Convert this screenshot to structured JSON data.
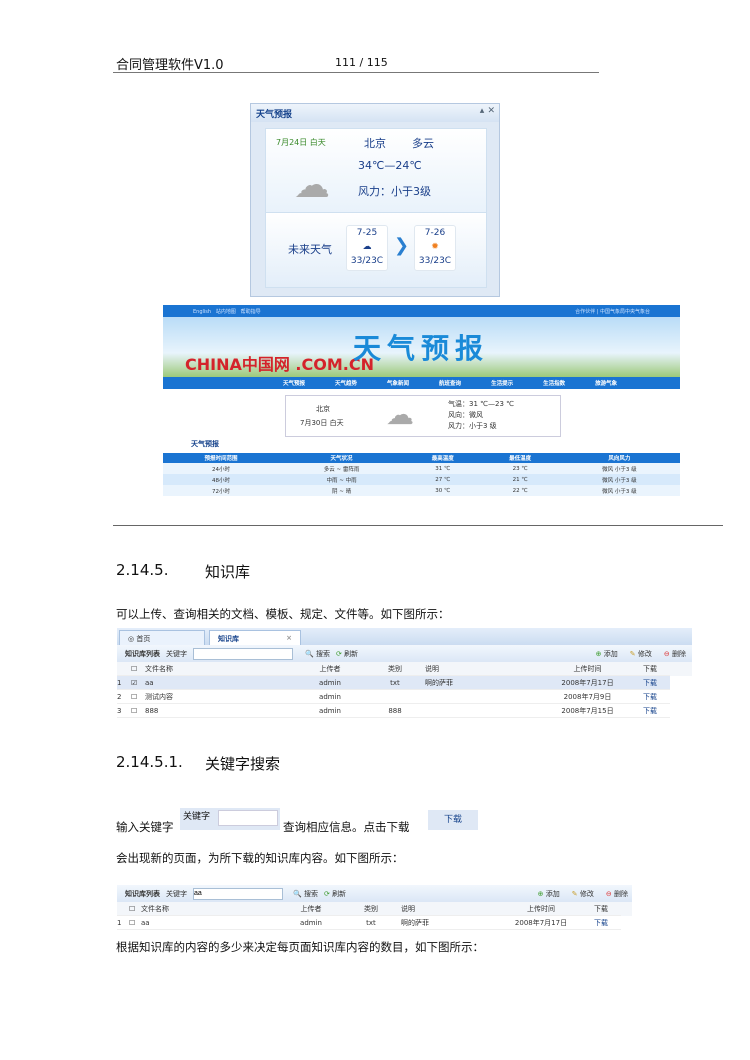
{
  "header": {
    "title": "合同管理软件V1.0",
    "page": "111 / 115"
  },
  "weather_widget": {
    "title": "天气预报",
    "date": "7月24日 白天",
    "city": "北京",
    "condition": "多云",
    "temp": "34℃—24℃",
    "wind": "风力：小于3级",
    "future_label": "未来天气",
    "days": [
      {
        "date": "7-25",
        "temp": "33/23C",
        "icon": "cloud-icon"
      },
      {
        "date": "7-26",
        "temp": "33/23C",
        "icon": "sun-icon"
      }
    ]
  },
  "weather_site": {
    "top_links": [
      "English",
      "站内地图",
      "帮助指导"
    ],
    "top_right": "合作伙伴 | 中国气象局中央气象台",
    "logo": "CHINA中国网 .COM.CN",
    "banner_title": "天气预报",
    "nav": [
      "天气预报",
      "天气趋势",
      "气象新闻",
      "航班查询",
      "生活提示",
      "生活指数",
      "旅游气象"
    ],
    "today": {
      "city": "北京",
      "date": "7月30日 白天",
      "temp": "气温：31 ℃—23 ℃",
      "wind_dir": "风向：微风",
      "wind": "风力：小于3 级"
    },
    "section": "天气预报",
    "table": {
      "headers": [
        "预报时间范围",
        "天气状况",
        "最高温度",
        "最低温度",
        "风向风力"
      ],
      "rows": [
        [
          "24小时",
          "多云 ~ 雷阵雨",
          "31 ℃",
          "23 ℃",
          "微风 小于3 级"
        ],
        [
          "48小时",
          "中雨 ~ 中雨",
          "27 ℃",
          "21 ℃",
          "微风 小于3 级"
        ],
        [
          "72小时",
          "阴 ~ 晴",
          "30 ℃",
          "22 ℃",
          "微风 小于3 级"
        ]
      ]
    }
  },
  "section1": {
    "number": "2.14.5.",
    "title": "知识库",
    "intro": "可以上传、查询相关的文档、模板、规定、文件等。如下图所示："
  },
  "kb": {
    "tabs": [
      "首页",
      "知识库"
    ],
    "list_title": "知识库列表",
    "keyword_label": "关键字",
    "search": "搜索",
    "refresh": "刷新",
    "add": "添加",
    "edit": "修改",
    "delete": "删除",
    "columns": [
      "文件名称",
      "上传者",
      "类别",
      "说明",
      "上传时间",
      "下载"
    ],
    "rows": [
      [
        "1",
        "aa",
        "admin",
        "txt",
        "啊的萨菲",
        "2008年7月17日",
        "下载"
      ],
      [
        "2",
        "测试内容",
        "admin",
        "",
        "",
        "2008年7月9日",
        "下载"
      ],
      [
        "3",
        "888",
        "admin",
        "888",
        "",
        "2008年7月15日",
        "下载"
      ]
    ]
  },
  "section2": {
    "number": "2.14.5.1.",
    "title": "关键字搜索",
    "line1_a": "输入关键字",
    "line1_b": "查询相应信息。点击下载",
    "keyword_label": "关键字",
    "download": "下载",
    "line2": "会出现新的页面，为所下载的知识库内容。如下图所示：",
    "search_value": "aa",
    "row": [
      "1",
      "aa",
      "admin",
      "txt",
      "啊的萨菲",
      "2008年7月17日",
      "下载"
    ],
    "line3": "根据知识库的内容的多少来决定每页面知识库内容的数目，如下图所示："
  }
}
